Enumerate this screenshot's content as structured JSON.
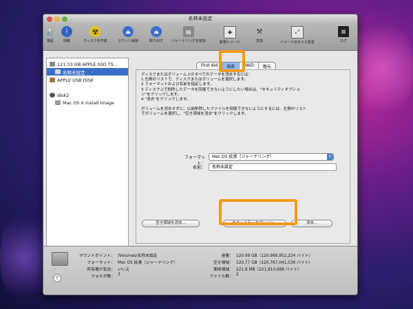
{
  "window": {
    "title": "名称未設定"
  },
  "toolbar": [
    {
      "icon": "magnifier-icon",
      "label": "検証"
    },
    {
      "icon": "info-icon",
      "label": "情報"
    },
    {
      "icon": "burn-icon",
      "label": "ディスクを作成"
    },
    {
      "icon": "eject-icon",
      "label": "マウント解除"
    },
    {
      "icon": "eject-icon",
      "label": "取り出す"
    },
    {
      "icon": "journal-icon",
      "label": "ジャーナリングを有効"
    },
    {
      "icon": "new-image-icon",
      "label": "新規イメージ"
    },
    {
      "icon": "convert-icon",
      "label": "変換"
    },
    {
      "icon": "resize-icon",
      "label": "イメージのサイズ変更"
    },
    {
      "icon": "log-icon",
      "label": "ログ"
    }
  ],
  "sidebar": {
    "items": [
      {
        "label": "121.33 GB APPLE SSD TS...",
        "selected": false
      },
      {
        "label": "名称未設定",
        "selected": true
      },
      {
        "label": "APPLE USB DISK",
        "selected": false
      },
      {
        "label": "disk2",
        "selected": false
      },
      {
        "label": "Mac OS X Install Image",
        "selected": false
      }
    ]
  },
  "tabs": [
    {
      "label": "First Aid",
      "active": false
    },
    {
      "label": "消去",
      "active": true
    },
    {
      "label": "RAID",
      "active": false
    },
    {
      "label": "復元",
      "active": false
    }
  ],
  "erase": {
    "instructions": [
      "ディスクまたはボリューム上のすべてのデータを消去するには：",
      "1 左側のリストで、ディスクまたはボリュームを選択します。",
      "2 フォーマットおよび名前を指定します。",
      "3 ディスク上で削除したデータを回復できないようにしたい場合は、\"セキュリティオプショ",
      "  ン\"をクリックします。",
      "4 \"消去\"をクリックします。",
      "",
      "ボリュームを消去せずに、以前削除したファイルを回復できないようにするには、左側のリスト",
      "でボリュームを選択し、\"空き領域を消去\"をクリックします。"
    ],
    "format_label": "フォーマット：",
    "format_value": "Mac OS 拡張（ジャーナリング）",
    "name_label": "名前：",
    "name_value": "名称未設定",
    "erase_free_space_button": "空き領域を消去...",
    "security_options_button": "セキュリティオプション...",
    "erase_button": "消去..."
  },
  "info": {
    "left": [
      {
        "label": "マウントポイント：",
        "value": "/Volumes/名称未設定"
      },
      {
        "label": "フォーマット：",
        "value": "Mac OS 拡張（ジャーナリング）"
      },
      {
        "label": "所有権が有効：",
        "value": "いいえ"
      },
      {
        "label": "フォルダ数：",
        "value": "3"
      }
    ],
    "right": [
      {
        "label": "容量：",
        "value": "120.99 GB（120,988,852,224 バイト）"
      },
      {
        "label": "空き領域：",
        "value": "120.77 GB（120,767,041,536 バイト）"
      },
      {
        "label": "使用領域：",
        "value": "221.8 MB（221,810,688 バイト）"
      },
      {
        "label": "ファイル数：",
        "value": "2"
      }
    ]
  },
  "colors": {
    "highlight": "#f39a1c",
    "selection": "#3a6fc9",
    "active_tab": "#8fb7ec"
  }
}
